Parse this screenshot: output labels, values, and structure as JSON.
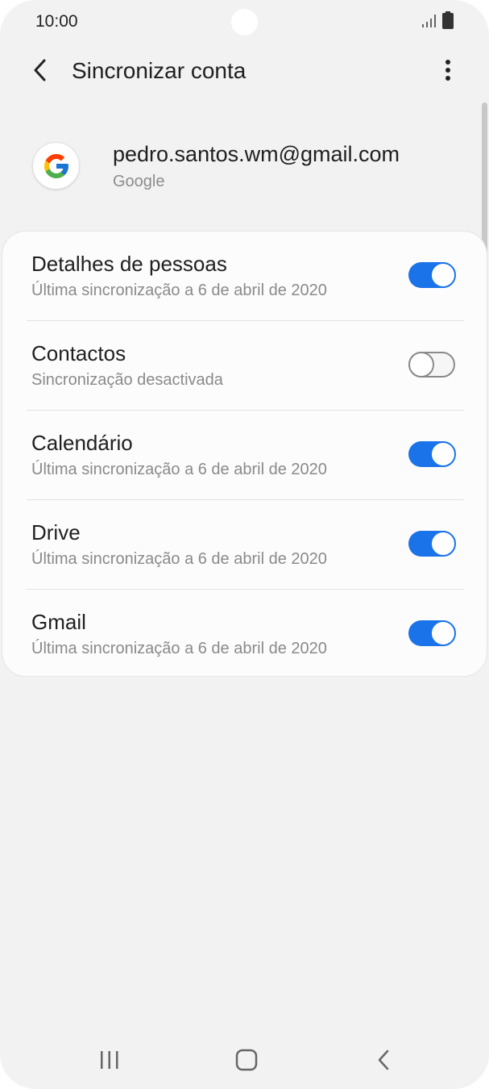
{
  "status_bar": {
    "time": "10:00",
    "signal_icon": "signal-icon",
    "battery_icon": "battery-icon"
  },
  "header": {
    "title": "Sincronizar conta",
    "back_icon": "chevron-left-icon",
    "more_icon": "more-vertical-icon"
  },
  "account": {
    "email": "pedro.santos.wm@gmail.com",
    "type": "Google",
    "avatar_icon": "google-logo"
  },
  "sync_items": [
    {
      "title": "Detalhes de pessoas",
      "status": "Última sincronização a 6 de abril de 2020",
      "enabled": true
    },
    {
      "title": "Contactos",
      "status": "Sincronização desactivada",
      "enabled": false
    },
    {
      "title": "Calendário",
      "status": "Última sincronização a 6 de abril de 2020",
      "enabled": true
    },
    {
      "title": "Drive",
      "status": "Última sincronização a 6 de abril de 2020",
      "enabled": true
    },
    {
      "title": "Gmail",
      "status": "Última sincronização a 6 de abril de 2020",
      "enabled": true
    }
  ],
  "nav_bar": {
    "recents_icon": "recents-icon",
    "home_icon": "home-icon",
    "back_icon": "back-icon"
  },
  "colors": {
    "accent": "#1a73e8",
    "background": "#f2f2f2",
    "card": "#fcfcfc",
    "secondary_text": "#8a8a8a"
  }
}
